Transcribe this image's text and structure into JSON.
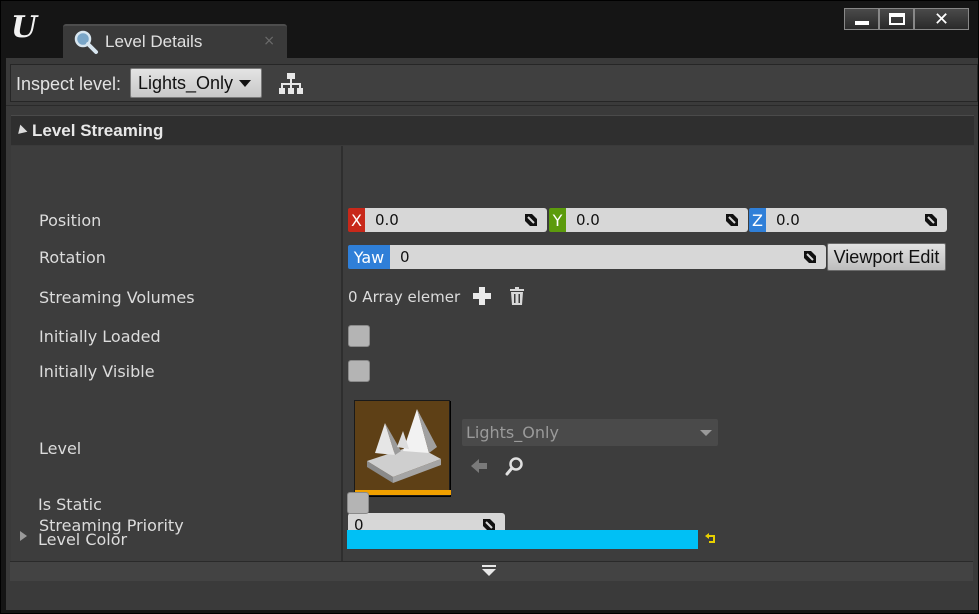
{
  "window": {
    "logo_text": "U",
    "tab_title": "Level Details",
    "tab_close": "×",
    "close_glyph": "✕"
  },
  "toolbar": {
    "inspect_label": "Inspect level:",
    "level_selected": "Lights_Only"
  },
  "category": {
    "title": "Level Streaming"
  },
  "properties": {
    "position": {
      "label": "Position",
      "x_axis": "X",
      "x": "0.0",
      "y_axis": "Y",
      "y": "0.0",
      "z_axis": "Z",
      "z": "0.0"
    },
    "rotation": {
      "label": "Rotation",
      "yaw_axis": "Yaw",
      "yaw": "0",
      "viewport_edit": "Viewport Edit"
    },
    "streaming_volumes": {
      "label": "Streaming Volumes",
      "value": "0 Array elemer"
    },
    "initially_loaded": {
      "label": "Initially Loaded",
      "checked": false
    },
    "initially_visible": {
      "label": "Initially Visible",
      "checked": false
    },
    "level": {
      "label": "Level",
      "asset": "Lights_Only"
    },
    "streaming_priority": {
      "label": "Streaming Priority",
      "value": "0"
    },
    "is_static": {
      "label": "Is Static",
      "checked": false
    },
    "level_color": {
      "label": "Level Color",
      "color": "#00C0F5"
    }
  },
  "colors": {
    "x_axis": "#C8281A",
    "y_axis": "#5C9B0C",
    "z_axis": "#2F7FD8",
    "thumbnail_accent": "#F0A000"
  }
}
